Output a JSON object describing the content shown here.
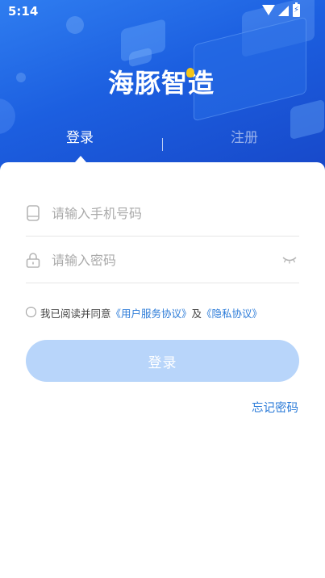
{
  "status_bar": {
    "time": "5:14"
  },
  "brand": {
    "logo_text": "海豚智造"
  },
  "tabs": [
    {
      "label": "登录"
    },
    {
      "label": "注册"
    }
  ],
  "form": {
    "phone": {
      "placeholder": "请输入手机号码",
      "value": ""
    },
    "password": {
      "placeholder": "请输入密码",
      "value": ""
    }
  },
  "agreement": {
    "checked": false,
    "prefix": "我已阅读并同意",
    "user_agreement": "《用户服务协议》",
    "and": "及",
    "privacy": "《隐私协议》"
  },
  "login_button": "登录",
  "forgot_password": "忘记密码",
  "colors": {
    "primary": "#1c5fe0",
    "link": "#2b7bd8",
    "button_disabled": "#b8d5fa"
  },
  "icons": [
    "wifi-icon",
    "signal-icon",
    "battery-icon",
    "phone-icon",
    "lock-icon",
    "eye-closed-icon"
  ]
}
